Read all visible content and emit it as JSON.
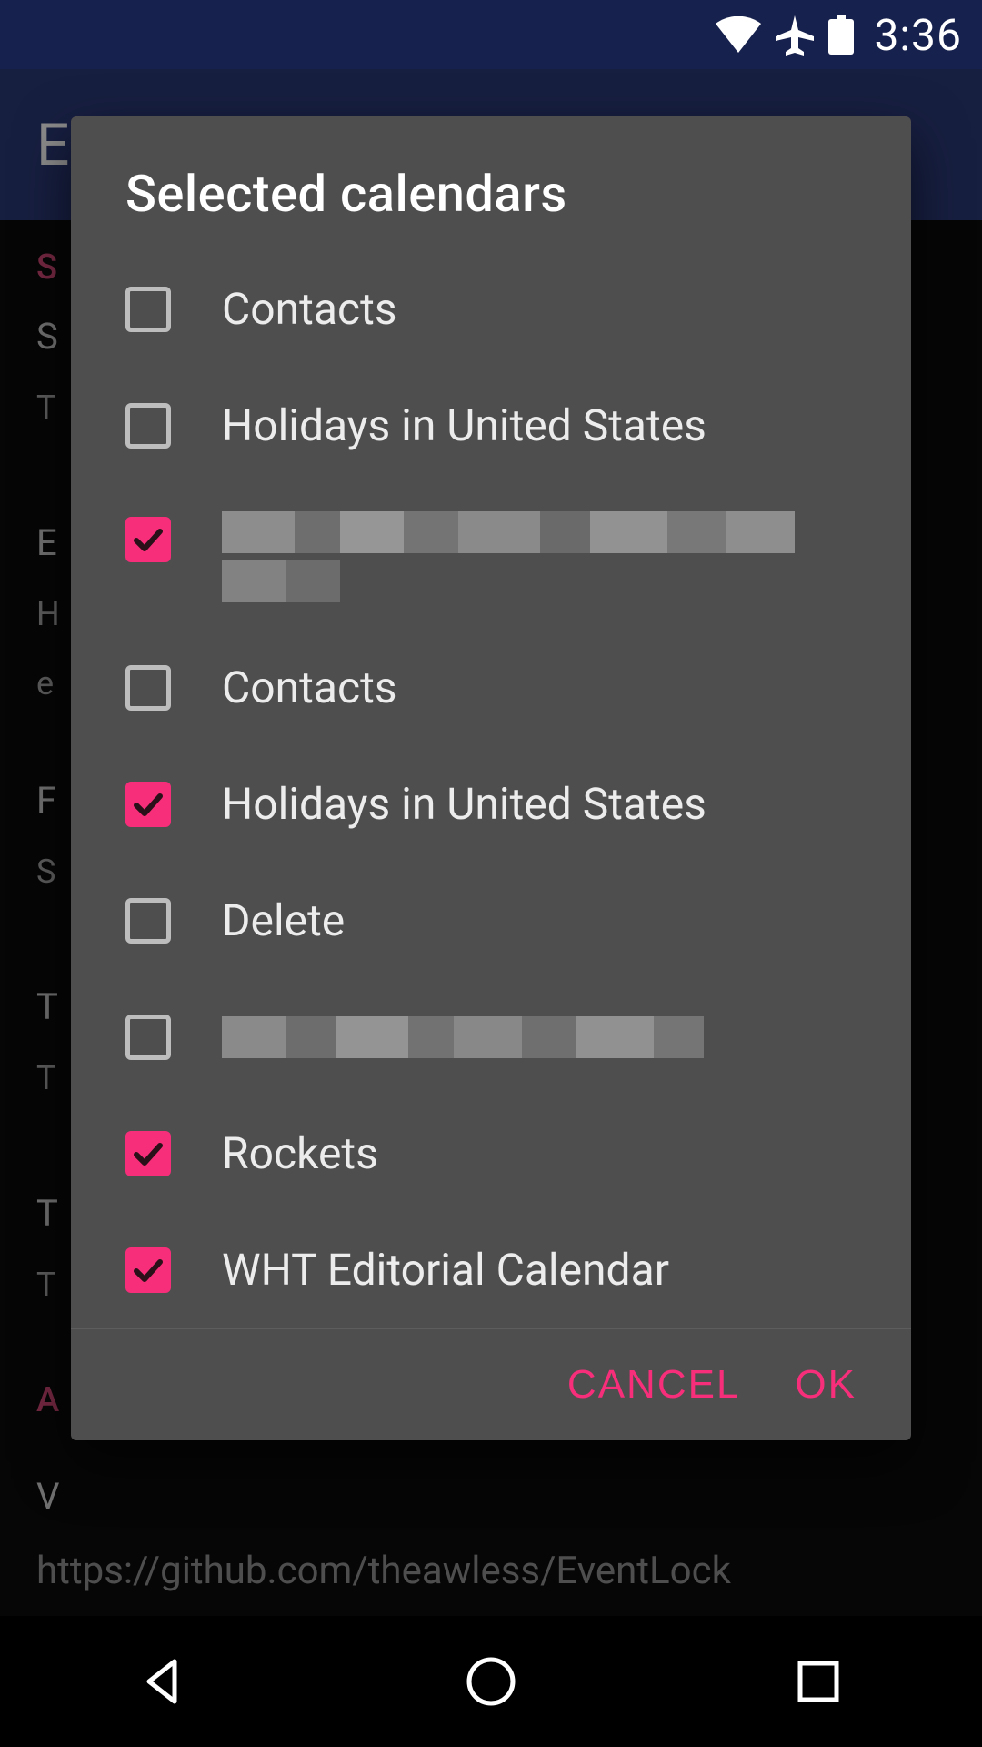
{
  "status": {
    "time": "3:36"
  },
  "background": {
    "app_title_fragment": "E",
    "section_labels": [
      "S"
    ],
    "rows": [
      {
        "t1": "S",
        "t2": "T"
      },
      {
        "t1": "E",
        "t2": "H",
        "t3": "e"
      },
      {
        "t1": "F",
        "t2": "S"
      },
      {
        "t1": "T",
        "t2": "T"
      },
      {
        "t1": "T",
        "t2": "T"
      }
    ],
    "section2": "A",
    "row2": "V",
    "url": "https://github.com/theawless/EventLock"
  },
  "dialog": {
    "title": "Selected calendars",
    "items": [
      {
        "label": "Contacts",
        "checked": false,
        "redacted": false
      },
      {
        "label": "Holidays in United States",
        "checked": false,
        "redacted": false
      },
      {
        "label": "",
        "checked": true,
        "redacted": true,
        "lines": 2
      },
      {
        "label": "Contacts",
        "checked": false,
        "redacted": false
      },
      {
        "label": "Holidays in United States",
        "checked": true,
        "redacted": false
      },
      {
        "label": "Delete",
        "checked": false,
        "redacted": false
      },
      {
        "label": "",
        "checked": false,
        "redacted": true,
        "lines": 1
      },
      {
        "label": "Rockets",
        "checked": true,
        "redacted": false
      },
      {
        "label": "WHT Editorial Calendar",
        "checked": true,
        "redacted": false
      }
    ],
    "cancel_label": "CANCEL",
    "ok_label": "OK"
  },
  "colors": {
    "accent": "#f72e7a"
  }
}
